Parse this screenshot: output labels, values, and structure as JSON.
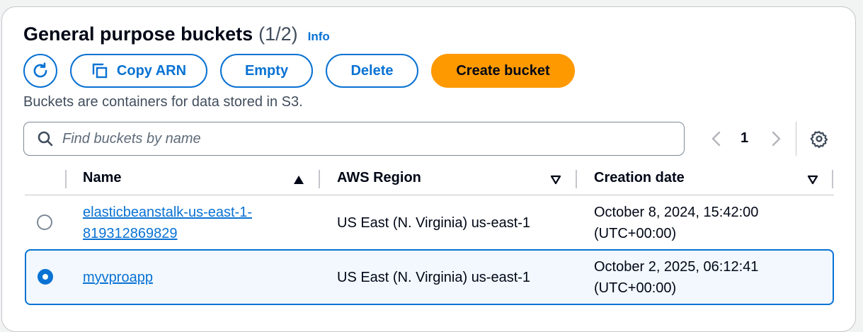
{
  "header": {
    "title": "General purpose buckets",
    "count": "(1/2)",
    "info": "Info"
  },
  "toolbar": {
    "refresh_icon": "refresh-icon",
    "copy_arn_label": "Copy ARN",
    "copy_icon": "copy-icon",
    "empty_label": "Empty",
    "delete_label": "Delete",
    "create_label": "Create bucket"
  },
  "description": "Buckets are containers for data stored in S3.",
  "search": {
    "placeholder": "Find buckets by name",
    "icon": "search-icon"
  },
  "pagination": {
    "current_page": "1",
    "prev_icon": "chevron-left-icon",
    "next_icon": "chevron-right-icon",
    "settings_icon": "gear-icon"
  },
  "table": {
    "columns": [
      "Name",
      "AWS Region",
      "Creation date"
    ],
    "rows": [
      {
        "name_line1": "elasticbeanstalk-us-east-1-",
        "name_line2": "819312869829",
        "region": "US East (N. Virginia) us-east-1",
        "date_line1": "October 8, 2024, 15:42:00",
        "date_line2": "(UTC+00:00)",
        "selected": false
      },
      {
        "name_line1": "myvproapp",
        "region": "US East (N. Virginia) us-east-1",
        "date_line1": "October 2, 2025, 06:12:41",
        "date_line2": "(UTC+00:00)",
        "selected": true
      }
    ]
  },
  "colors": {
    "accent": "#0972d3",
    "primary_button": "#ff9900",
    "selected_row_bg": "#f2f8fd"
  }
}
